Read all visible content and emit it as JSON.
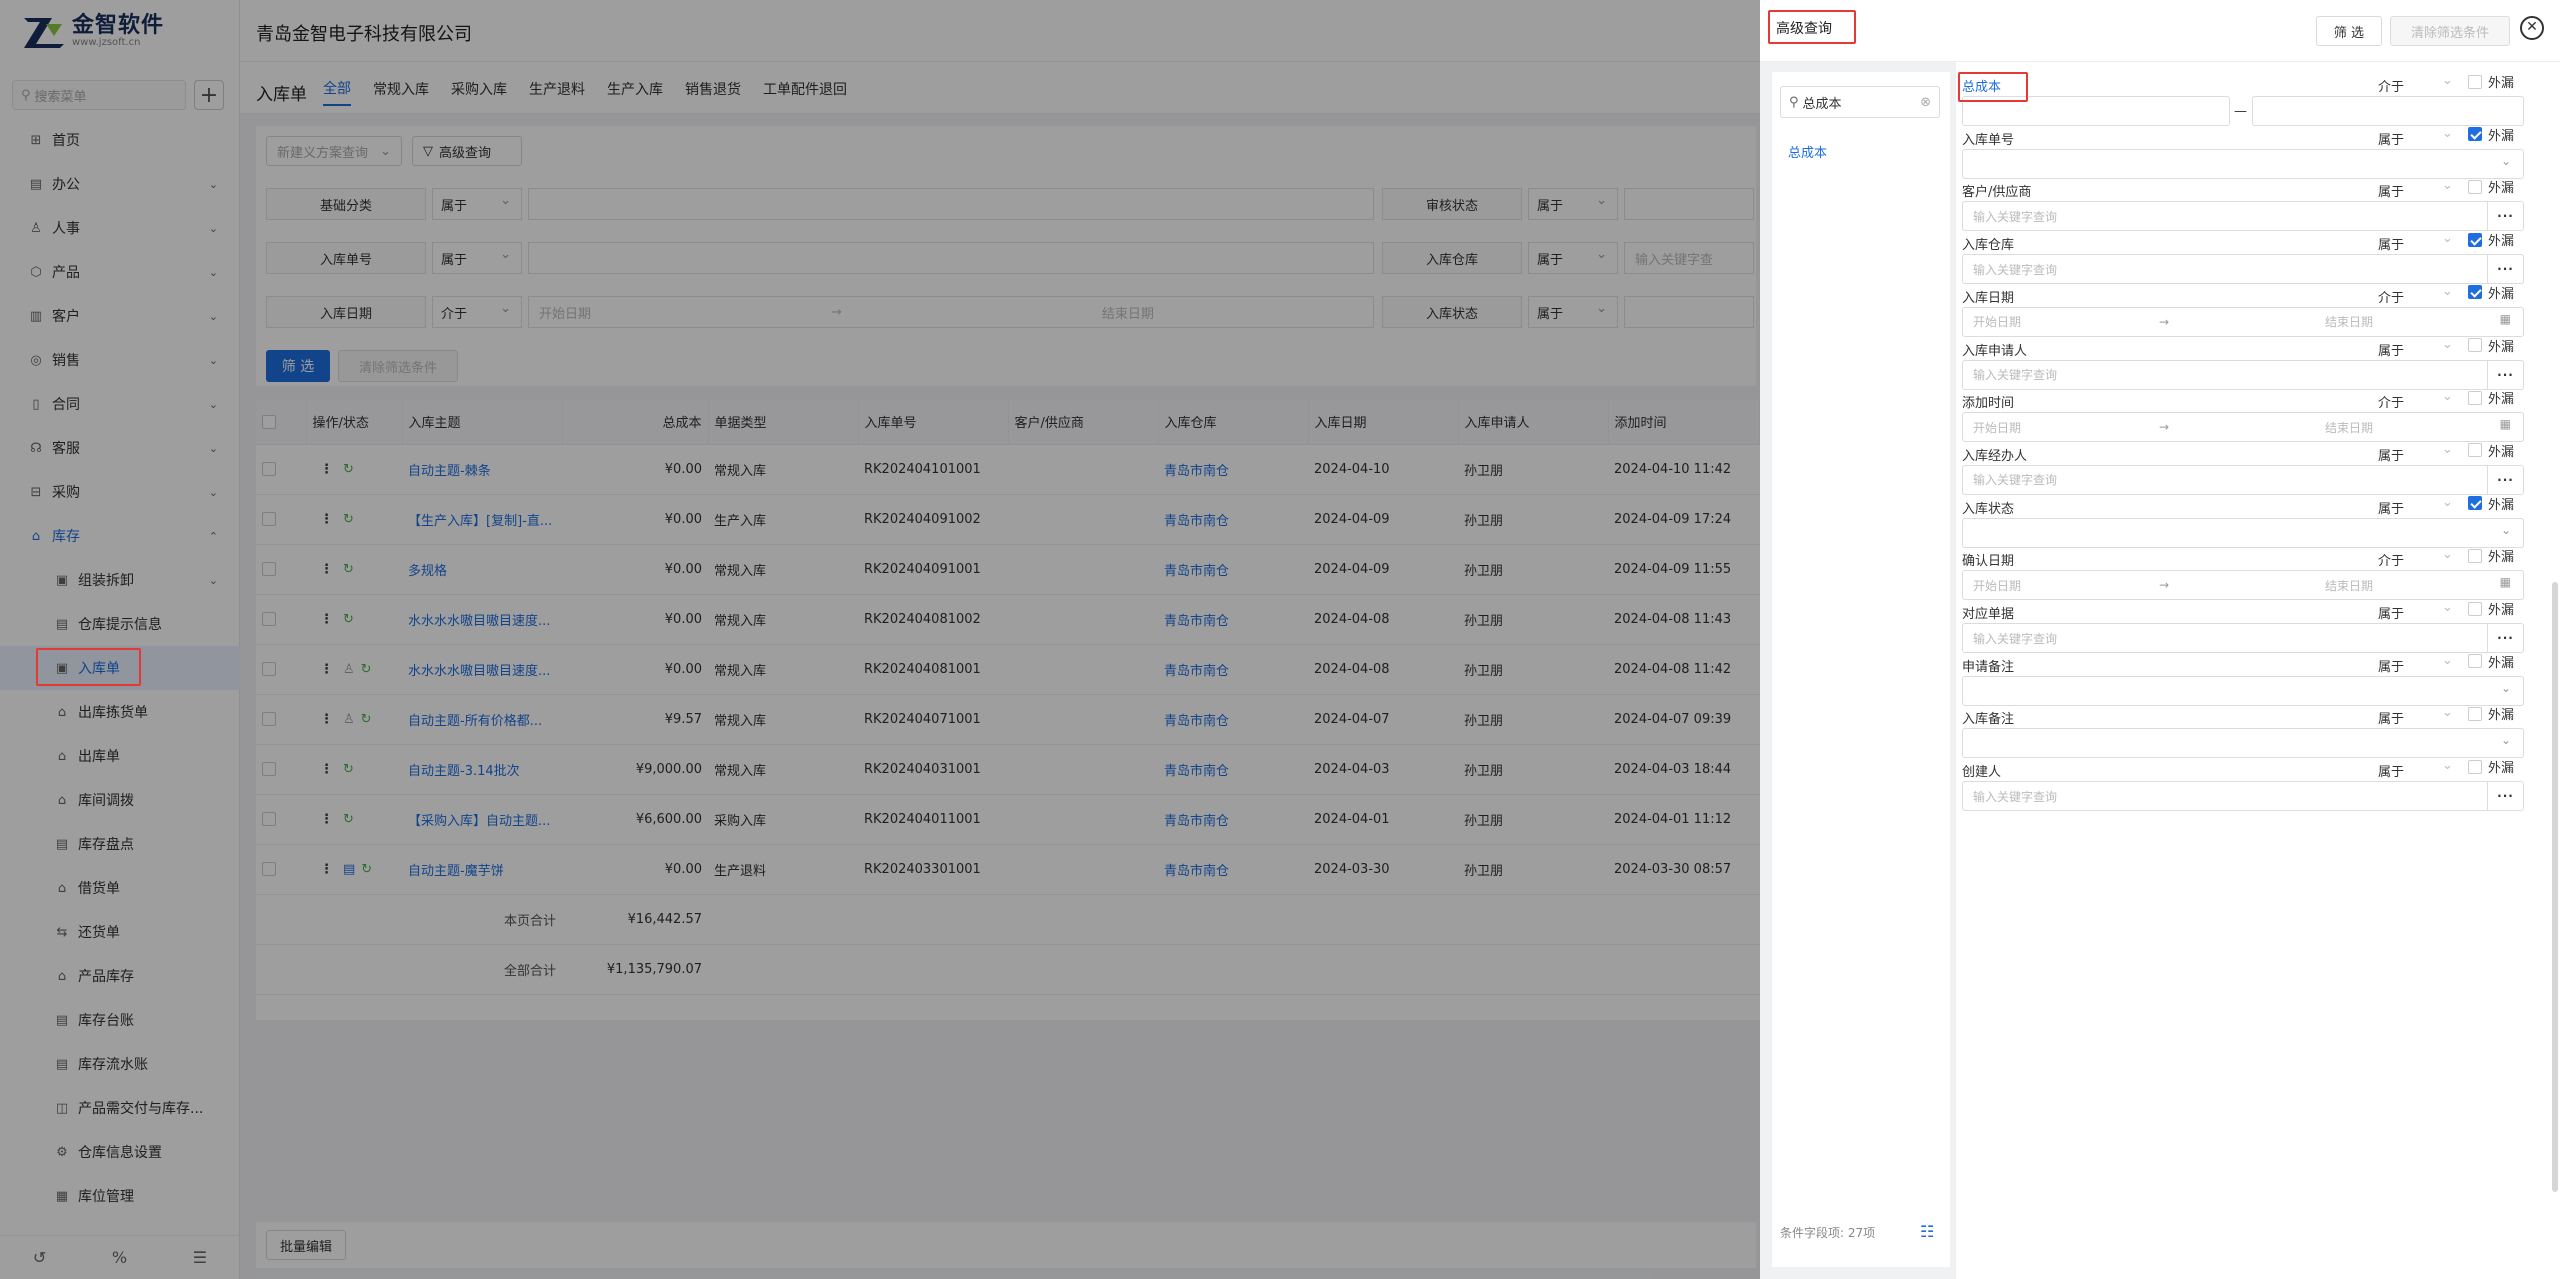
{
  "logo": {
    "name": "金智软件",
    "url": "www.jzsoft.cn"
  },
  "search": {
    "placeholder": "搜索菜单"
  },
  "sidebar": {
    "items": [
      {
        "label": "首页",
        "icon": "grid-icon"
      },
      {
        "label": "办公",
        "icon": "briefcase-icon"
      },
      {
        "label": "人事",
        "icon": "person-icon"
      },
      {
        "label": "产品",
        "icon": "box-icon"
      },
      {
        "label": "客户",
        "icon": "user-icon"
      },
      {
        "label": "销售",
        "icon": "globe-icon"
      },
      {
        "label": "合同",
        "icon": "doc-icon"
      },
      {
        "label": "客服",
        "icon": "headset-icon"
      },
      {
        "label": "采购",
        "icon": "cart-icon"
      },
      {
        "label": "库存",
        "icon": "warehouse-icon"
      }
    ],
    "sub": [
      "组装拆卸",
      "仓库提示信息",
      "入库单",
      "出库拣货单",
      "出库单",
      "库间调拨",
      "库存盘点",
      "借货单",
      "还货单",
      "产品库存",
      "库存台账",
      "库存流水账",
      "产品需交付与库存...",
      "仓库信息设置",
      "库位管理"
    ]
  },
  "company": "青岛金智电子科技有限公司",
  "tabs": {
    "title": "入库单",
    "items": [
      "全部",
      "常规入库",
      "采购入库",
      "生产退料",
      "生产入库",
      "销售退货",
      "工单配件退回"
    ]
  },
  "filter": {
    "quick": "新建义方案查询",
    "advanced": "高级查询",
    "rows": [
      {
        "label": "基础分类",
        "op": "属于",
        "label2": "审核状态",
        "op2": "属于"
      },
      {
        "label": "入库单号",
        "op": "属于",
        "label2": "入库仓库",
        "op2": "属于",
        "ph2": "输入关键字查"
      },
      {
        "label": "入库日期",
        "op": "介于",
        "start": "开始日期",
        "end": "结束日期",
        "label2": "入库状态",
        "op2": "属于"
      }
    ],
    "btn": "筛 选",
    "clear": "清除筛选条件"
  },
  "table": {
    "headers": [
      "操作/状态",
      "入库主题",
      "总成本",
      "单据类型",
      "入库单号",
      "客户/供应商",
      "入库仓库",
      "入库日期",
      "入库申请人",
      "添加时间"
    ],
    "rows": [
      [
        "自动主题-棘条",
        "¥0.00",
        "常规入库",
        "RK202404101001",
        "青岛市南仓",
        "2024-04-10",
        "孙卫朋",
        "2024-04-10 11:42"
      ],
      [
        "【生产入库】[复制]-直...",
        "¥0.00",
        "生产入库",
        "RK202404091002",
        "青岛市南仓",
        "2024-04-09",
        "孙卫朋",
        "2024-04-09 17:24"
      ],
      [
        "多规格",
        "¥0.00",
        "常规入库",
        "RK202404091001",
        "青岛市南仓",
        "2024-04-09",
        "孙卫朋",
        "2024-04-09 11:55"
      ],
      [
        "水水水水嗷目嗷目速度...",
        "¥0.00",
        "常规入库",
        "RK202404081002",
        "青岛市南仓",
        "2024-04-08",
        "孙卫朋",
        "2024-04-08 11:43"
      ],
      [
        "水水水水嗷目嗷目速度...",
        "¥0.00",
        "常规入库",
        "RK202404081001",
        "青岛市南仓",
        "2024-04-08",
        "孙卫朋",
        "2024-04-08 11:42"
      ],
      [
        "自动主题-所有价格都...",
        "¥9.57",
        "常规入库",
        "RK202404071001",
        "青岛市南仓",
        "2024-04-07",
        "孙卫朋",
        "2024-04-07 09:39"
      ],
      [
        "自动主题-3.14批次",
        "¥9,000.00",
        "常规入库",
        "RK202404031001",
        "青岛市南仓",
        "2024-04-03",
        "孙卫朋",
        "2024-04-03 18:44"
      ],
      [
        "【采购入库】自动主题...",
        "¥6,600.00",
        "采购入库",
        "RK202404011001",
        "青岛市南仓",
        "2024-04-01",
        "孙卫朋",
        "2024-04-01 11:12"
      ],
      [
        "自动主题-魔芋饼",
        "¥0.00",
        "生产退料",
        "RK202403301001",
        "青岛市南仓",
        "2024-03-30",
        "孙卫朋",
        "2024-03-30 08:57"
      ]
    ],
    "page_total_label": "本页合计",
    "page_total": "¥16,442.57",
    "all_total_label": "全部合计",
    "all_total": "¥1,135,790.07",
    "batch_edit": "批量编辑"
  },
  "panel": {
    "title": "高级查询",
    "filter_btn": "筛 选",
    "clear_btn": "清除筛选条件",
    "search_value": "总成本",
    "left_item": "总成本",
    "count_label": "条件字段项: 27项",
    "outside_label": "外漏",
    "fields": [
      {
        "label": "总成本",
        "op": "介于",
        "checked": false,
        "type": "range"
      },
      {
        "label": "入库单号",
        "op": "属于",
        "checked": true,
        "type": "select",
        "ph": ""
      },
      {
        "label": "客户/供应商",
        "op": "属于",
        "checked": false,
        "type": "more",
        "ph": "输入关键字查询"
      },
      {
        "label": "入库仓库",
        "op": "属于",
        "checked": true,
        "type": "more",
        "ph": "输入关键字查询"
      },
      {
        "label": "入库日期",
        "op": "介于",
        "checked": true,
        "type": "date",
        "ph": "开始日期",
        "ph2": "结束日期"
      },
      {
        "label": "入库申请人",
        "op": "属于",
        "checked": false,
        "type": "more",
        "ph": "输入关键字查询"
      },
      {
        "label": "添加时间",
        "op": "介于",
        "checked": false,
        "type": "date",
        "ph": "开始日期",
        "ph2": "结束日期"
      },
      {
        "label": "入库经办人",
        "op": "属于",
        "checked": false,
        "type": "more",
        "ph": "输入关键字查询"
      },
      {
        "label": "入库状态",
        "op": "属于",
        "checked": true,
        "type": "select",
        "ph": ""
      },
      {
        "label": "确认日期",
        "op": "介于",
        "checked": false,
        "type": "date",
        "ph": "开始日期",
        "ph2": "结束日期"
      },
      {
        "label": "对应单据",
        "op": "属于",
        "checked": false,
        "type": "more",
        "ph": "输入关键字查询"
      },
      {
        "label": "申请备注",
        "op": "属于",
        "checked": false,
        "type": "select",
        "ph": ""
      },
      {
        "label": "入库备注",
        "op": "属于",
        "checked": false,
        "type": "select",
        "ph": ""
      },
      {
        "label": "创建人",
        "op": "属于",
        "checked": false,
        "type": "more",
        "ph": "输入关键字查询"
      }
    ]
  }
}
